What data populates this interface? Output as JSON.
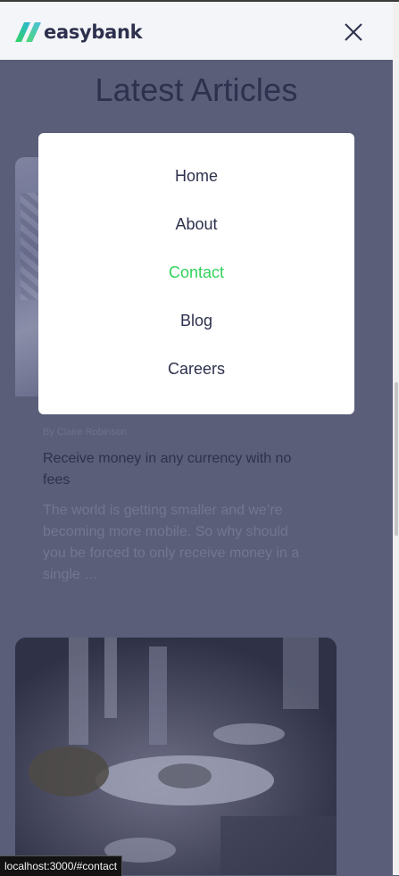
{
  "header": {
    "logo_text": "easybank",
    "logo_icon": "easybank-logo-icon",
    "close_icon": "close-icon"
  },
  "articles": {
    "section_title": "Latest Articles",
    "card1": {
      "author": "By Claire Robinson",
      "title": "Receive money in any currency with no fees",
      "excerpt": "The world is getting smaller and we’re becoming more mobile. So why should you be forced to only receive money in a single …"
    }
  },
  "menu": {
    "items": [
      {
        "label": "Home",
        "active": false
      },
      {
        "label": "About",
        "active": false
      },
      {
        "label": "Contact",
        "active": true
      },
      {
        "label": "Blog",
        "active": false
      },
      {
        "label": "Careers",
        "active": false
      }
    ]
  },
  "status_bar": {
    "url": "localhost:3000/#contact"
  },
  "colors": {
    "primary_text": "#2d314d",
    "accent_green": "#31d35c",
    "accent_cyan": "#2bb7da",
    "overlay": "#5b5e79"
  }
}
